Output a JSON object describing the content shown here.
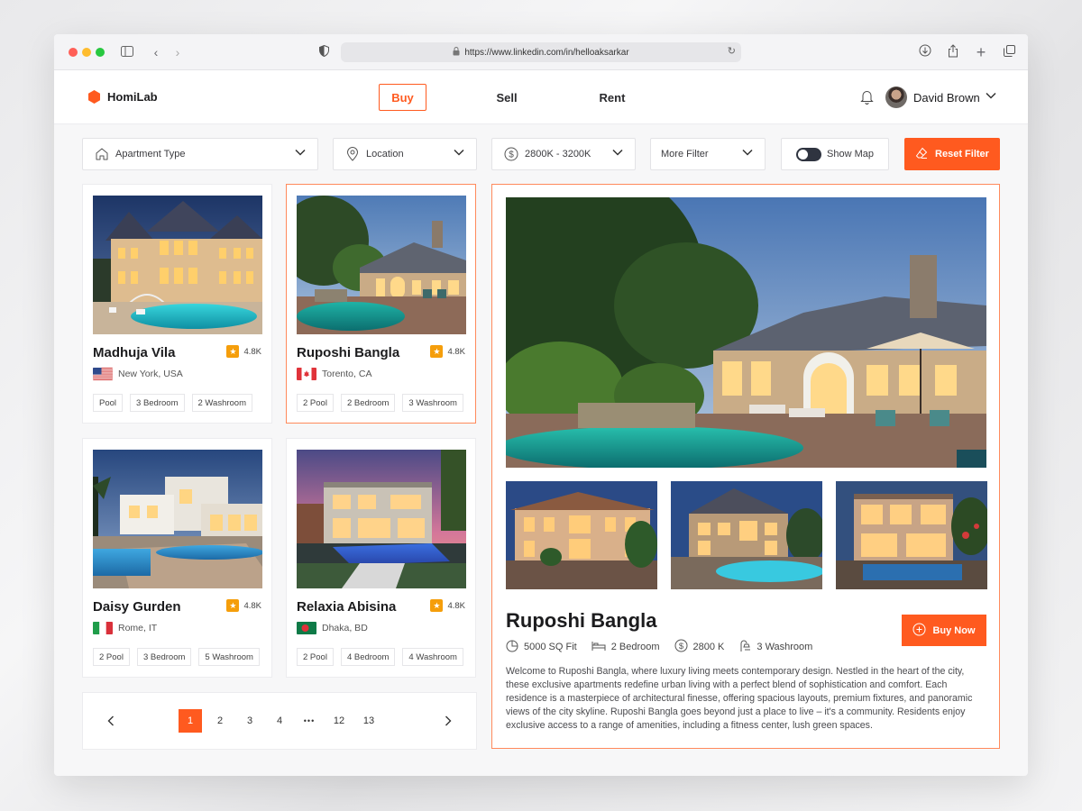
{
  "browser": {
    "url": "https://www.linkedin.com/in/helloaksarkar"
  },
  "header": {
    "brand": "HomiLab",
    "tabs": [
      {
        "label": "Buy",
        "active": true
      },
      {
        "label": "Sell",
        "active": false
      },
      {
        "label": "Rent",
        "active": false
      }
    ],
    "user_name": "David Brown"
  },
  "filters": {
    "apartment_type": "Apartment Type",
    "location": "Location",
    "price": "2800K - 3200K",
    "more": "More Filter",
    "show_map": "Show Map",
    "reset": "Reset Filter"
  },
  "properties": [
    {
      "name": "Madhuja Vila",
      "rating": "4.8K",
      "location": "New York, USA",
      "flag": "usa",
      "tags": [
        "Pool",
        "3 Bedroom",
        "2 Washroom"
      ],
      "selected": false
    },
    {
      "name": "Ruposhi Bangla",
      "rating": "4.8K",
      "location": "Torento, CA",
      "flag": "canada",
      "tags": [
        "2 Pool",
        "2 Bedroom",
        "3 Washroom"
      ],
      "selected": true
    },
    {
      "name": "Daisy Gurden",
      "rating": "4.8K",
      "location": "Rome, IT",
      "flag": "italy",
      "tags": [
        "2 Pool",
        "3 Bedroom",
        "5 Washroom"
      ],
      "selected": false
    },
    {
      "name": "Relaxia Abisina",
      "rating": "4.8K",
      "location": "Dhaka, BD",
      "flag": "bangladesh",
      "tags": [
        "2 Pool",
        "4 Bedroom",
        "4 Washroom"
      ],
      "selected": false
    }
  ],
  "pagination": {
    "pages": [
      "1",
      "2",
      "3",
      "4",
      "•••",
      "12",
      "13"
    ],
    "current": "1"
  },
  "detail": {
    "title": "Ruposhi Bangla",
    "buy_label": "Buy Now",
    "specs": {
      "area": "5000 SQ Fit",
      "bedrooms": "2 Bedroom",
      "price": "2800 K",
      "washrooms": "3 Washroom"
    },
    "description": "Welcome to Ruposhi Bangla, where luxury living meets contemporary design. Nestled in the heart of the city, these exclusive apartments redefine urban living with a perfect blend of sophistication and comfort. Each residence is a masterpiece of architectural finesse, offering spacious layouts, premium fixtures, and panoramic views of the city skyline. Ruposhi Bangla goes beyond just a place to live – it's a community. Residents enjoy exclusive access to a range of amenities, including a fitness center, lush green spaces."
  },
  "colors": {
    "accent": "#ff5a1f",
    "star": "#f59e0b",
    "selected_border": "#ff8a5c"
  }
}
